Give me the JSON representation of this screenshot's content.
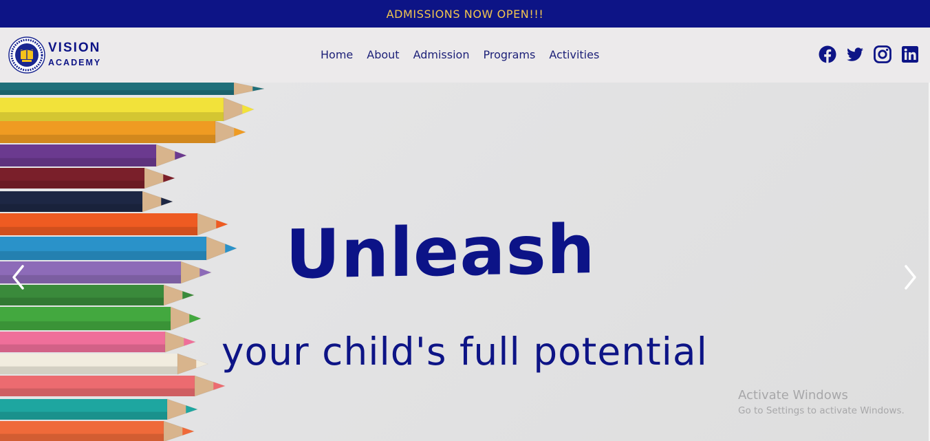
{
  "announcement": "ADMISSIONS NOW OPEN!!!",
  "brand": {
    "name": "VISION",
    "sub": "ACADEMY"
  },
  "nav": [
    {
      "label": "Home"
    },
    {
      "label": "About"
    },
    {
      "label": "Admission"
    },
    {
      "label": "Programs"
    },
    {
      "label": "Activities"
    }
  ],
  "social": [
    {
      "icon": "facebook-icon"
    },
    {
      "icon": "twitter-icon"
    },
    {
      "icon": "instagram-icon"
    },
    {
      "icon": "linkedin-icon"
    }
  ],
  "hero": {
    "headline": "Unleash",
    "subline": "your child's full potential",
    "prev_icon": "chevron-left-icon",
    "next_icon": "chevron-right-icon"
  },
  "watermark": {
    "title": "Activate Windows",
    "subtitle": "Go to Settings to activate Windows."
  },
  "colors": {
    "brand_navy": "#0d1486",
    "announcement_text": "#f3c64f",
    "header_bg": "#eceaeb"
  }
}
